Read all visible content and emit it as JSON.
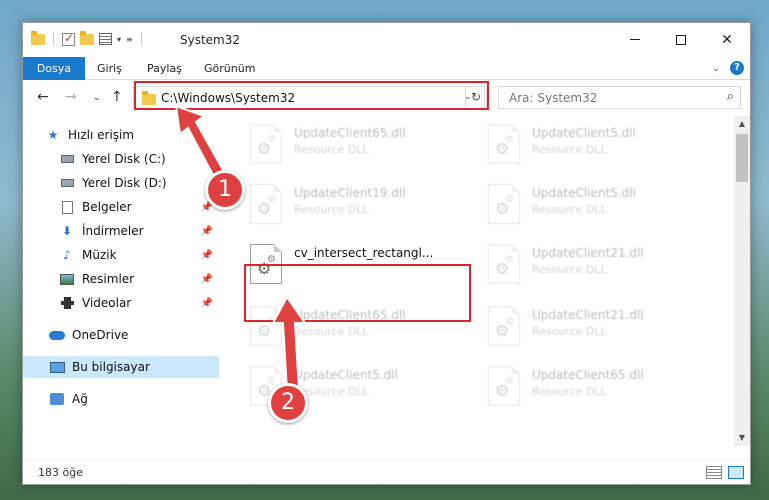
{
  "window": {
    "title": "System32",
    "controls": {
      "minimize": "—",
      "maximize": "☐",
      "close": "✕"
    }
  },
  "ribbon": {
    "tabs": [
      "Dosya",
      "Giriş",
      "Paylaş",
      "Görünüm"
    ],
    "help": "?"
  },
  "address": {
    "path": "C:\\Windows\\System32",
    "refresh": "↻",
    "search_placeholder": "Ara: System32"
  },
  "sidebar": {
    "items": [
      {
        "label": "Hızlı erişim",
        "icon": "star-icon"
      },
      {
        "label": "Yerel Disk (C:)",
        "icon": "drive-icon"
      },
      {
        "label": "Yerel Disk (D:)",
        "icon": "drive-icon"
      },
      {
        "label": "Belgeler",
        "icon": "documents-icon",
        "pinned": true
      },
      {
        "label": "İndirmeler",
        "icon": "downloads-icon",
        "pinned": true
      },
      {
        "label": "Müzik",
        "icon": "music-icon",
        "pinned": true
      },
      {
        "label": "Resimler",
        "icon": "pictures-icon",
        "pinned": true
      },
      {
        "label": "Videolar",
        "icon": "videos-icon",
        "pinned": true
      },
      {
        "label": "OneDrive",
        "icon": "onedrive-icon"
      },
      {
        "label": "Bu bilgisayar",
        "icon": "this-pc-icon",
        "selected": true
      },
      {
        "label": "Ağ",
        "icon": "network-icon"
      }
    ]
  },
  "files": [
    {
      "name": "UpdateClient65.dll",
      "type": "Resource DLL"
    },
    {
      "name": "UpdateClient5.dll",
      "type": "Resource DLL"
    },
    {
      "name": "UpdateClient19.dll",
      "type": "Resource DLL"
    },
    {
      "name": "UpdateClient5.dll",
      "type": "Resource DLL"
    },
    {
      "name": "cv_intersect_rectangl...",
      "type": "",
      "highlighted": true
    },
    {
      "name": "UpdateClient21.dll",
      "type": "Resource DLL"
    },
    {
      "name": "UpdateClient65.dll",
      "type": "Resource DLL"
    },
    {
      "name": "UpdateClient21.dll",
      "type": "Resource DLL"
    },
    {
      "name": "UpdateClient5.dll",
      "type": "Resource DLL"
    },
    {
      "name": "UpdateClient65.dll",
      "type": "Resource DLL"
    }
  ],
  "status": {
    "item_count": "183 öğe"
  },
  "annotations": {
    "step1": "1",
    "step2": "2"
  },
  "colors": {
    "accent": "#1979ca",
    "highlight": "#d9262c",
    "badge": "#e0403f",
    "selected": "#cce8ff"
  }
}
